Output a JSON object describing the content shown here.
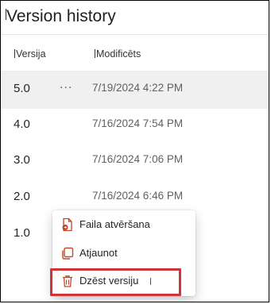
{
  "panel": {
    "title": "Version history"
  },
  "columns": {
    "version": "Versija",
    "modified": "Modificēts"
  },
  "versions": [
    {
      "version": "5.0",
      "modified": "7/19/2024 4:22 PM",
      "selected": true
    },
    {
      "version": "4.0",
      "modified": "7/16/2024 7:54 PM"
    },
    {
      "version": "3.0",
      "modified": "7/16/2024 7:06 PM"
    },
    {
      "version": "2.0",
      "modified": "7/16/2024 6:46 PM"
    },
    {
      "version": "1.0",
      "modified": ""
    }
  ],
  "more_label": "...",
  "context_menu": {
    "items": [
      {
        "label": "Faila atvēršana",
        "icon": "open-file-icon"
      },
      {
        "label": "Atjaunot",
        "icon": "restore-icon"
      },
      {
        "label": "Dzēst versiju",
        "icon": "delete-icon"
      }
    ]
  },
  "colors": {
    "highlight": "#d13438",
    "selected_row": "#f0f0f0",
    "icon_accent": "#c4462a"
  }
}
